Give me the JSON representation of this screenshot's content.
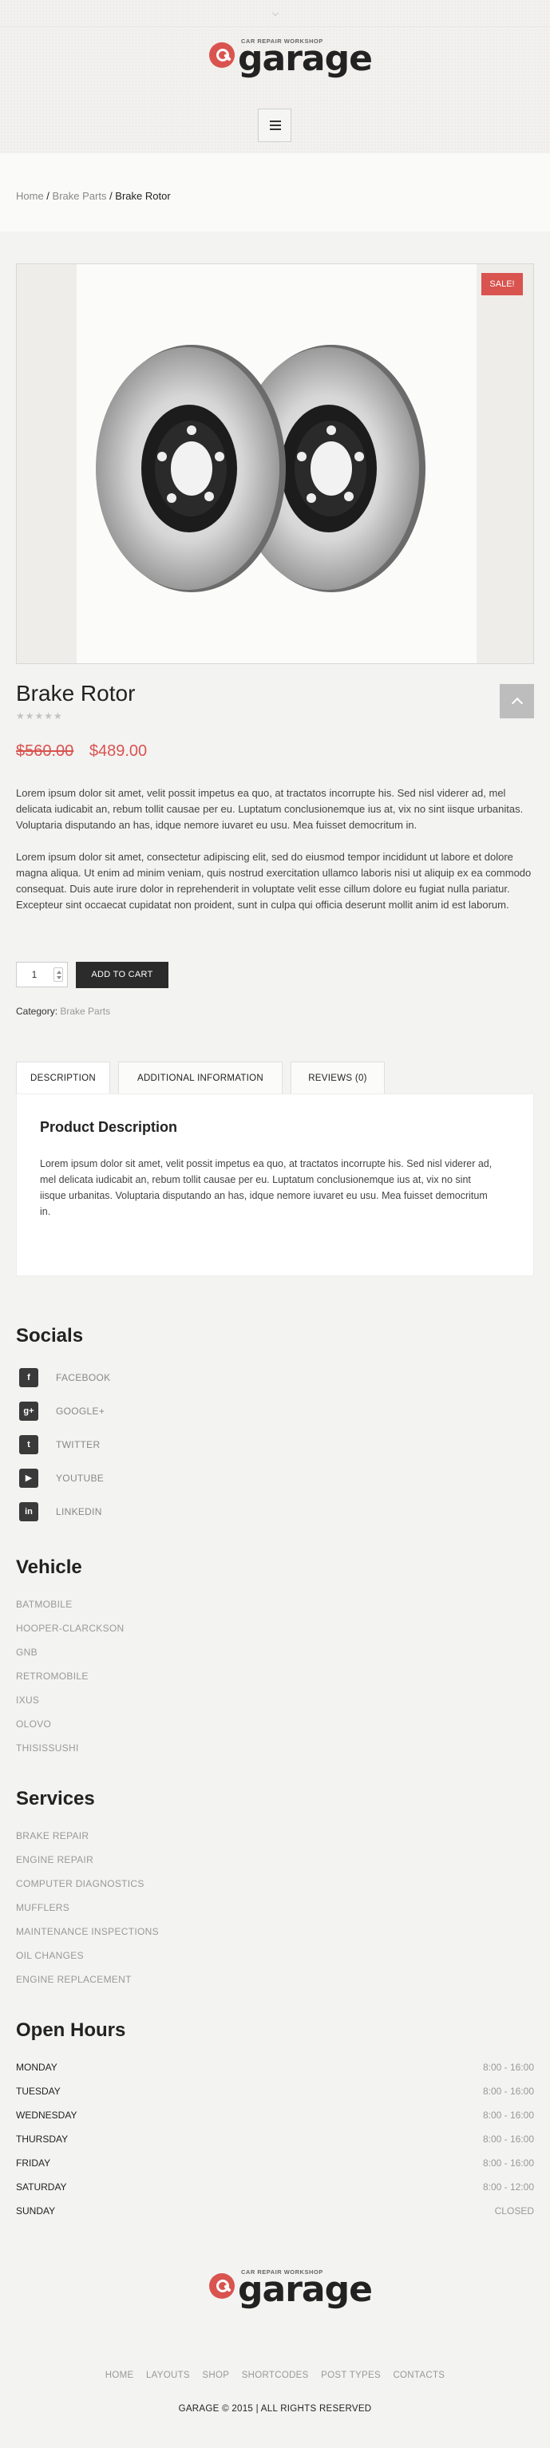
{
  "brand": {
    "tagline": "CAR REPAIR WORKSHOP",
    "name": "garage"
  },
  "breadcrumb": {
    "home": "Home",
    "sep1": " / ",
    "category": "Brake Parts",
    "sep2": " / ",
    "current": "Brake Rotor"
  },
  "product": {
    "sale_badge": "SALE!",
    "title": "Brake Rotor",
    "rating_stars": "★★★★★",
    "rating": 0,
    "price_old": "$560.00",
    "price_new": "$489.00",
    "description_1": "Lorem ipsum dolor sit amet, velit possit impetus ea quo, at tractatos incorrupte his. Sed nisl viderer ad, mel delicata iudicabit an, rebum tollit causae per eu. Luptatum conclusionemque ius at, vix no sint iisque urbanitas. Voluptaria disputando an has, idque nemore iuvaret eu usu. Mea fuisset democritum in.",
    "description_2": "Lorem ipsum dolor sit amet, consectetur adipiscing elit, sed do eiusmod tempor incididunt ut labore et dolore magna aliqua. Ut enim ad minim veniam, quis nostrud exercitation ullamco laboris nisi ut aliquip ex ea commodo consequat. Duis aute irure dolor in reprehenderit in voluptate velit esse cillum dolore eu fugiat nulla pariatur. Excepteur sint occaecat cupidatat non proident, sunt in culpa qui officia deserunt mollit anim id est laborum.",
    "quantity": "1",
    "add_to_cart": "ADD TO CART",
    "category_label": "Category:",
    "category_value": "Brake Parts"
  },
  "tabs": [
    {
      "label": "DESCRIPTION"
    },
    {
      "label": "ADDITIONAL INFORMATION"
    },
    {
      "label": "REVIEWS (0)"
    }
  ],
  "tab_panel": {
    "title": "Product Description",
    "text": "Lorem ipsum dolor sit amet, velit possit impetus ea quo, at tractatos incorrupte his. Sed nisl viderer ad, mel delicata iudicabit an, rebum tollit causae per eu. Luptatum conclusionemque ius at, vix no sint iisque urbanitas. Voluptaria disputando an has, idque nemore iuvaret eu usu. Mea fuisset democritum in."
  },
  "socials": {
    "title": "Socials",
    "items": [
      {
        "label": "FACEBOOK",
        "icon": "facebook-icon",
        "glyph": "f"
      },
      {
        "label": "GOOGLE+",
        "icon": "google-plus-icon",
        "glyph": "g+"
      },
      {
        "label": "TWITTER",
        "icon": "twitter-icon",
        "glyph": "t"
      },
      {
        "label": "YOUTUBE",
        "icon": "youtube-icon",
        "glyph": "▶"
      },
      {
        "label": "LINKEDIN",
        "icon": "linkedin-icon",
        "glyph": "in"
      }
    ]
  },
  "vehicle": {
    "title": "Vehicle",
    "items": [
      "BATMOBILE",
      "HOOPER-CLARCKSON",
      "GNB",
      "RETROMOBILE",
      "IXUS",
      "OLOVO",
      "THISISSUSHI"
    ]
  },
  "services": {
    "title": "Services",
    "items": [
      "BRAKE REPAIR",
      "ENGINE REPAIR",
      "COMPUTER DIAGNOSTICS",
      "MUFFLERS",
      "MAINTENANCE INSPECTIONS",
      "OIL CHANGES",
      "ENGINE REPLACEMENT"
    ]
  },
  "hours": {
    "title": "Open Hours",
    "rows": [
      {
        "day": "MONDAY",
        "time": "8:00 - 16:00"
      },
      {
        "day": "TUESDAY",
        "time": "8:00 - 16:00"
      },
      {
        "day": "WEDNESDAY",
        "time": "8:00 - 16:00"
      },
      {
        "day": "THURSDAY",
        "time": "8:00 - 16:00"
      },
      {
        "day": "FRIDAY",
        "time": "8:00 - 16:00"
      },
      {
        "day": "SATURDAY",
        "time": "8:00 - 12:00"
      },
      {
        "day": "SUNDAY",
        "time": "CLOSED"
      }
    ]
  },
  "footer": {
    "nav": [
      "HOME",
      "LAYOUTS",
      "SHOP",
      "SHORTCODES",
      "POST TYPES",
      "CONTACTS"
    ],
    "copyright": "GARAGE © 2015 | ALL RIGHTS RESERVED"
  },
  "colors": {
    "accent": "#d9534f",
    "dark": "#2b2b2b",
    "muted": "#999999"
  }
}
